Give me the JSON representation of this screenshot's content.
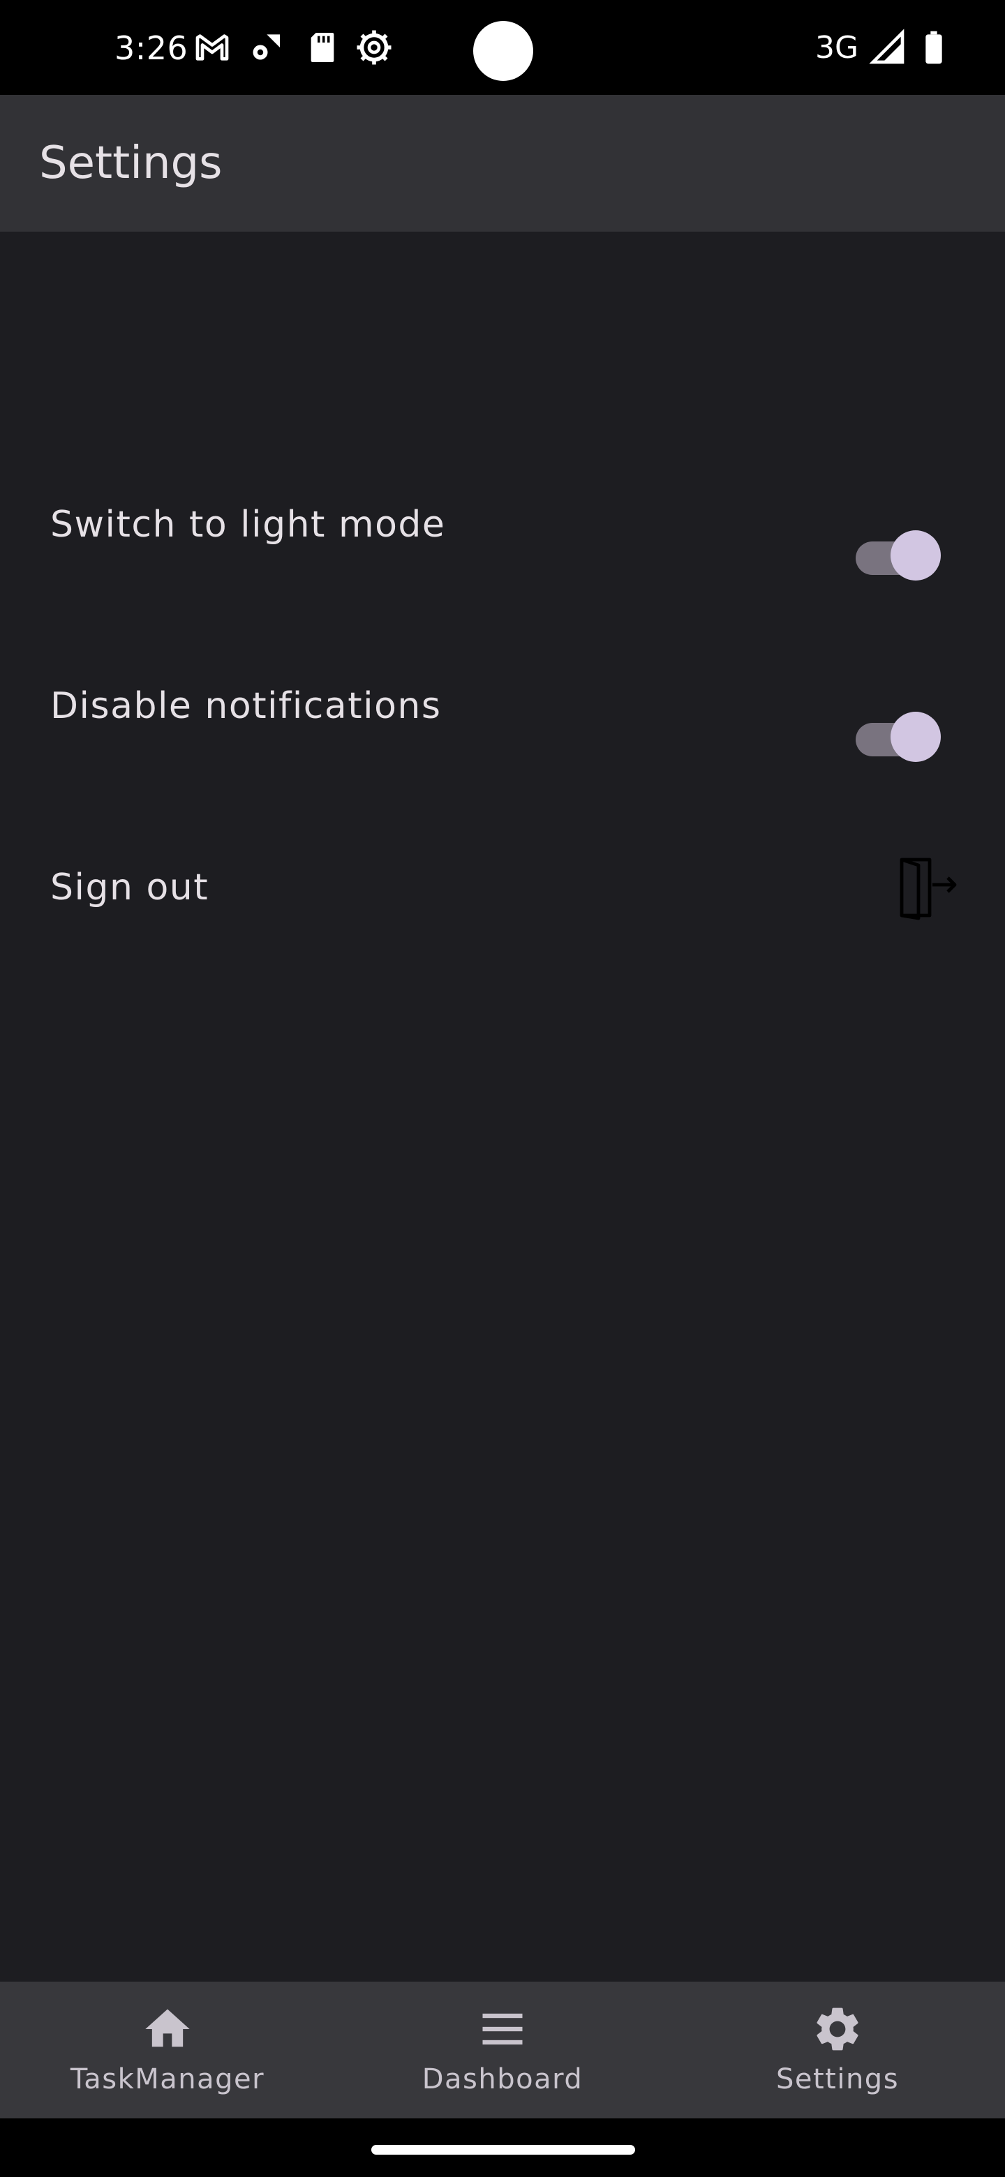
{
  "status_bar": {
    "time": "3:26",
    "network": "3G",
    "icons": [
      "gmail-icon",
      "gear-sync-icon",
      "sd-card-icon",
      "settings-badge-icon",
      "signal-icon",
      "battery-icon"
    ]
  },
  "app_bar": {
    "title": "Settings"
  },
  "settings": {
    "light_mode": {
      "label": "Switch to light mode",
      "checked": true
    },
    "notifications": {
      "label": "Disable notifications",
      "checked": true
    },
    "sign_out": {
      "label": "Sign out",
      "icon": "sign-out-icon"
    }
  },
  "bottom_nav": {
    "items": [
      {
        "label": "TaskManager",
        "icon": "home-icon"
      },
      {
        "label": "Dashboard",
        "icon": "menu-icon"
      },
      {
        "label": "Settings",
        "icon": "gear-icon"
      }
    ]
  },
  "colors": {
    "background": "#1d1d21",
    "app_bar": "#323236",
    "bottom_nav": "#38383c",
    "text": "#e6e1e6",
    "toggle_thumb": "#d2c6e2",
    "toggle_track": "#79737f"
  }
}
